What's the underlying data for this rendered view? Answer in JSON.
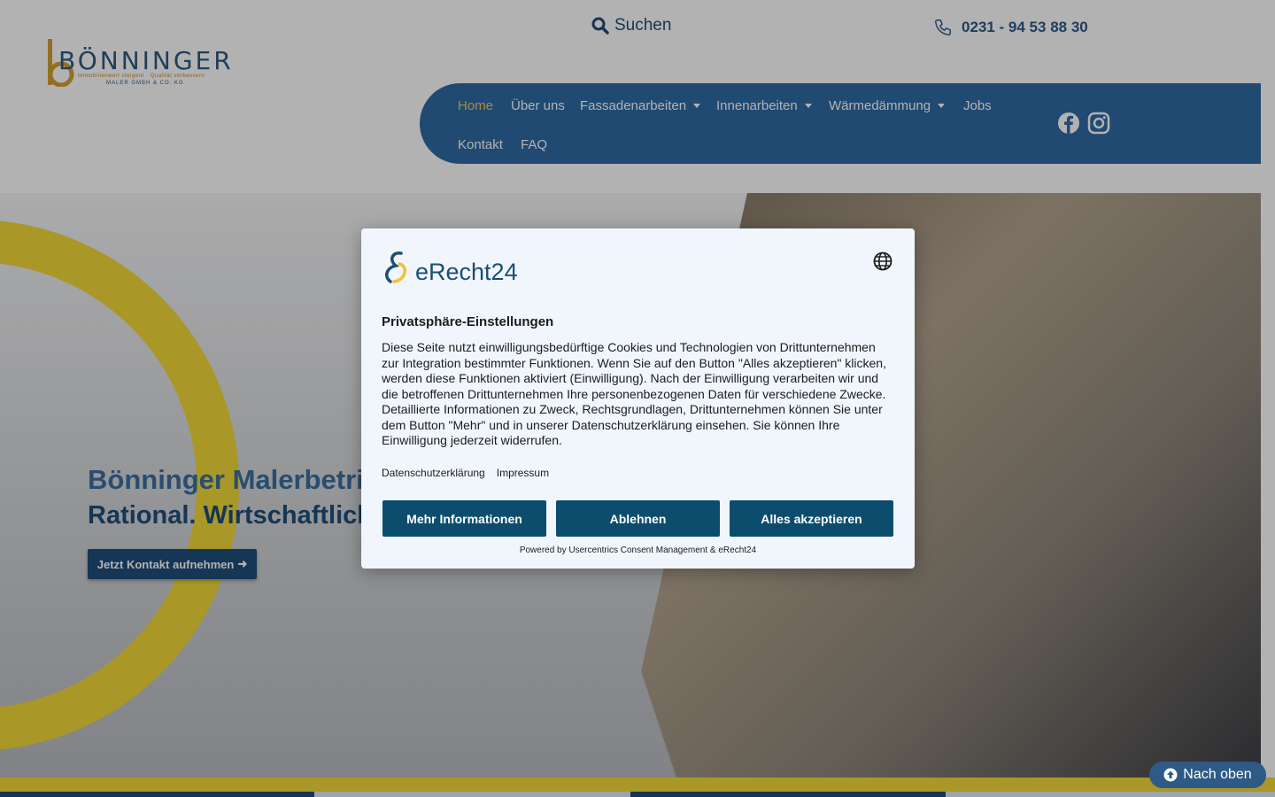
{
  "header": {
    "logo": {
      "name": "BÖNNINGER",
      "tagline": "Immobilienwert steigern · Qualität verbessern",
      "subline": "MALER GMBH & CO. KG"
    },
    "search_label": "Suchen",
    "phone": "0231 - 94 53 88 30"
  },
  "nav": {
    "items": [
      {
        "label": "Home",
        "active": true
      },
      {
        "label": "Über uns"
      },
      {
        "label": "Fassadenarbeiten",
        "dropdown": true
      },
      {
        "label": "Innenarbeiten",
        "dropdown": true
      },
      {
        "label": "Wärmedämmung",
        "dropdown": true
      },
      {
        "label": "Jobs"
      },
      {
        "label": "Kontakt"
      },
      {
        "label": "FAQ"
      }
    ],
    "social": [
      "facebook-icon",
      "instagram-icon"
    ]
  },
  "hero": {
    "title": "Bönninger Malerbetrieb",
    "subtitle": "Rational. Wirtschaftlich.",
    "cta": "Jetzt Kontakt aufnehmen"
  },
  "consent": {
    "brand": "eRecht24",
    "title": "Privatsphäre-Einstellungen",
    "body": "Diese Seite nutzt einwilligungsbedürftige Cookies und Technologien von Drittunternehmen zur Integration bestimmter Funktionen. Wenn Sie auf den Button \"Alles akzeptieren\" klicken, werden diese Funktionen aktiviert (Einwilligung). Nach der Einwilligung verarbeiten wir und die betroffenen Drittunternehmen Ihre personenbezogenen Daten für verschiedene Zwecke. Detaillierte Informationen zu Zweck, Rechtsgrundlagen, Drittunternehmen können Sie unter dem Button \"Mehr\" und in unserer Datenschutzerklärung einsehen. Sie können Ihre Einwilligung jederzeit widerrufen.",
    "links": {
      "privacy": "Datenschutzerklärung",
      "imprint": "Impressum"
    },
    "buttons": {
      "more": "Mehr Informationen",
      "decline": "Ablehnen",
      "accept": "Alles akzeptieren"
    },
    "powered_by": "Powered by Usercentrics Consent Management & eRecht24"
  },
  "back_to_top": "Nach oben",
  "colors": {
    "brand_blue": "#2f6aa3",
    "dark_blue": "#1f4e79",
    "accent_yellow": "#f2d93a",
    "consent_button": "#0c4d6e"
  }
}
